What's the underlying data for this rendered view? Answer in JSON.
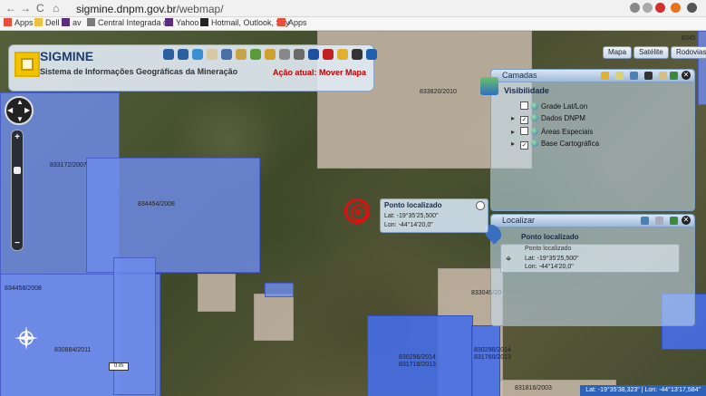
{
  "browser": {
    "url_domain": "sigmine.dnpm.gov.br",
    "url_path": "/webmap/",
    "bookmarks": [
      {
        "label": "Apps",
        "color": "#e84f3d"
      },
      {
        "label": "Dell",
        "color": "#f0c040"
      },
      {
        "label": "av",
        "color": "#5a2d82"
      },
      {
        "label": "Central Integrada de",
        "color": "#7a7a7a"
      },
      {
        "label": "Yahoo",
        "color": "#5a2d82"
      },
      {
        "label": "Hotmail, Outlook, Sky",
        "color": "#222222"
      },
      {
        "label": "Apps",
        "color": "#e84f3d"
      }
    ]
  },
  "header": {
    "title": "SIGMINE",
    "subtitle": "Sistema de Informações Geográficas da Mineração",
    "action_status": "Ação atual: Mover Mapa"
  },
  "map_type_buttons": [
    "Mapa",
    "Satélite",
    "Rodovias"
  ],
  "layers_panel": {
    "title": "Camadas",
    "section": "Visibilidade",
    "items": [
      {
        "label": "Grade Lat/Lon",
        "checked": false,
        "expandable": false
      },
      {
        "label": "Dados DNPM",
        "checked": true,
        "expandable": true
      },
      {
        "label": "Áreas Especiais",
        "checked": false,
        "expandable": true
      },
      {
        "label": "Base Cartográfica",
        "checked": true,
        "expandable": true
      }
    ]
  },
  "locate_panel": {
    "title": "Localizar",
    "section": "Ponto localizado",
    "box_title": "Ponto localizado",
    "lat": "Lat: -19°35'25,500\"",
    "lon": "Lon: -44°14'20,0\""
  },
  "popup": {
    "title": "Ponto localizado",
    "lat": "Lat: -19°35'25,500\"",
    "lon": "Lon: -44°14'20,0\""
  },
  "parcel_labels": [
    "833820/2010",
    "833172/2007",
    "834454/2008",
    "834458/2008",
    "833045/20",
    "830884/2011",
    "830296/2014",
    "831718/2013",
    "831760/2013",
    "830298/2014",
    "831816/2003",
    "8345"
  ],
  "status_bar": "Lat: -19°35'38,323\" | Lon: -44°13'17,584\"",
  "scale_label": "0 m",
  "colors": {
    "parcel_blue": "#6e8ceb",
    "parcel_tan": "#cdbeaf",
    "accent_red": "#e01010"
  }
}
